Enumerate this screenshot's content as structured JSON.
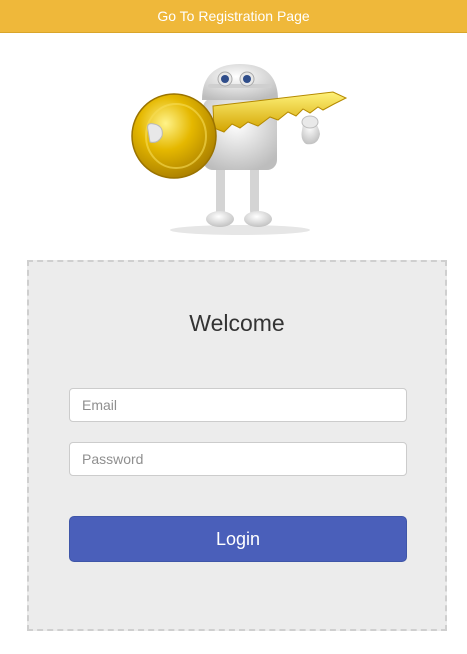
{
  "header": {
    "registration_link": "Go To Registration Page"
  },
  "hero": {
    "icon": "robot-holding-key-illustration"
  },
  "login_form": {
    "title": "Welcome",
    "email_placeholder": "Email",
    "email_value": "",
    "password_placeholder": "Password",
    "password_value": "",
    "login_label": "Login"
  },
  "colors": {
    "topbar": "#efb83a",
    "card_background": "#ececec",
    "login_button": "#4a5fba",
    "key_gold": "#e2b400"
  }
}
